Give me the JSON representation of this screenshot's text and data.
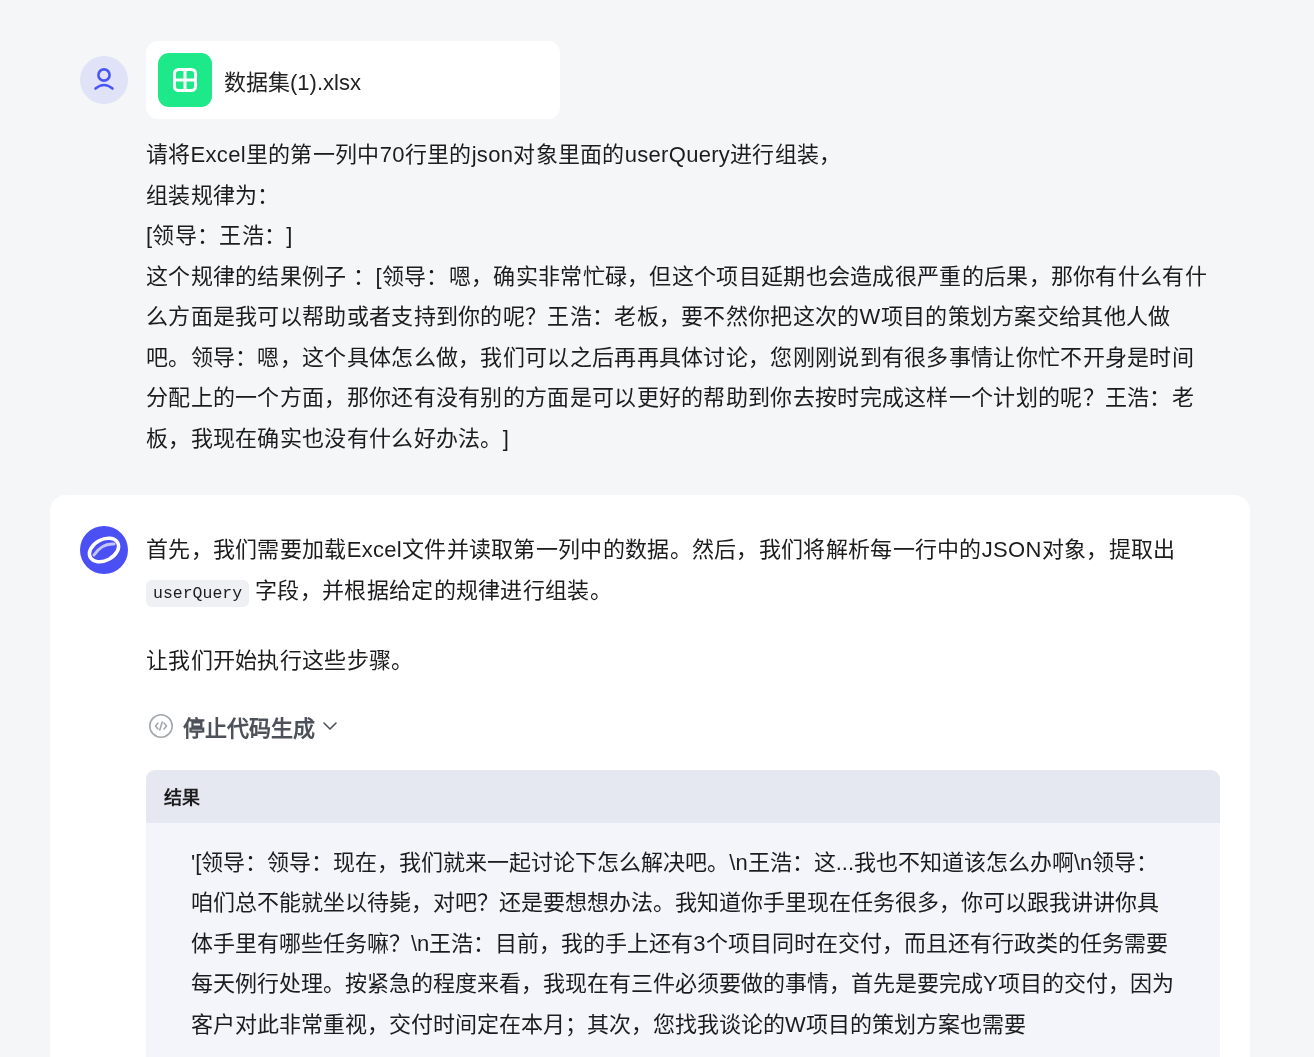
{
  "user_message": {
    "attachment": {
      "file_name": "数据集(1).xlsx"
    },
    "lines": [
      "请将Excel里的第一列中70行里的json对象里面的userQuery进行组装，",
      "组装规律为：",
      "[领导：王浩：]",
      "这个规律的结果例子 ：[领导：嗯，确实非常忙碌，但这个项目延期也会造成很严重的后果，那你有什么有什么方面是我可以帮助或者支持到你的呢？王浩：老板，要不然你把这次的W项目的策划方案交给其他人做吧。领导：嗯，这个具体怎么做，我们可以之后再再具体讨论，您刚刚说到有很多事情让你忙不开身是时间分配上的一个方面，那你还有没有别的方面是可以更好的帮助到你去按时完成这样一个计划的呢？王浩：老板，我现在确实也没有什么好办法。]"
    ]
  },
  "assistant_message": {
    "paragraphs": [
      {
        "parts": [
          {
            "kind": "text",
            "text": "首先，我们需要加载Excel文件并读取第一列中的数据。然后，我们将解析每一行中的JSON对象，提取出"
          },
          {
            "kind": "code",
            "text": "userQuery"
          },
          {
            "kind": "text",
            "text": "字段，并根据给定的规律进行组装。"
          }
        ]
      },
      {
        "parts": [
          {
            "kind": "text",
            "text": "让我们开始执行这些步骤。"
          }
        ]
      }
    ],
    "code_status": {
      "label": "停止代码生成"
    },
    "result": {
      "title": "结果",
      "text": "'[领导：领导：现在，我们就来一起讨论下怎么解决吧。\\n王浩：这...我也不知道该怎么办啊\\n领导：咱们总不能就坐以待毙，对吧？还是要想想办法。我知道你手里现在任务很多，你可以跟我讲讲你具体手里有哪些任务嘛？\\n王浩：目前，我的手上还有3个项目同时在交付，而且还有行政类的任务需要每天例行处理。按紧急的程度来看，我现在有三件必须要做的事情，首先是要完成Y项目的交付，因为客户对此非常重视，交付时间定在本月；其次，您找我谈论的W项目的策划方案也需要"
    }
  }
}
